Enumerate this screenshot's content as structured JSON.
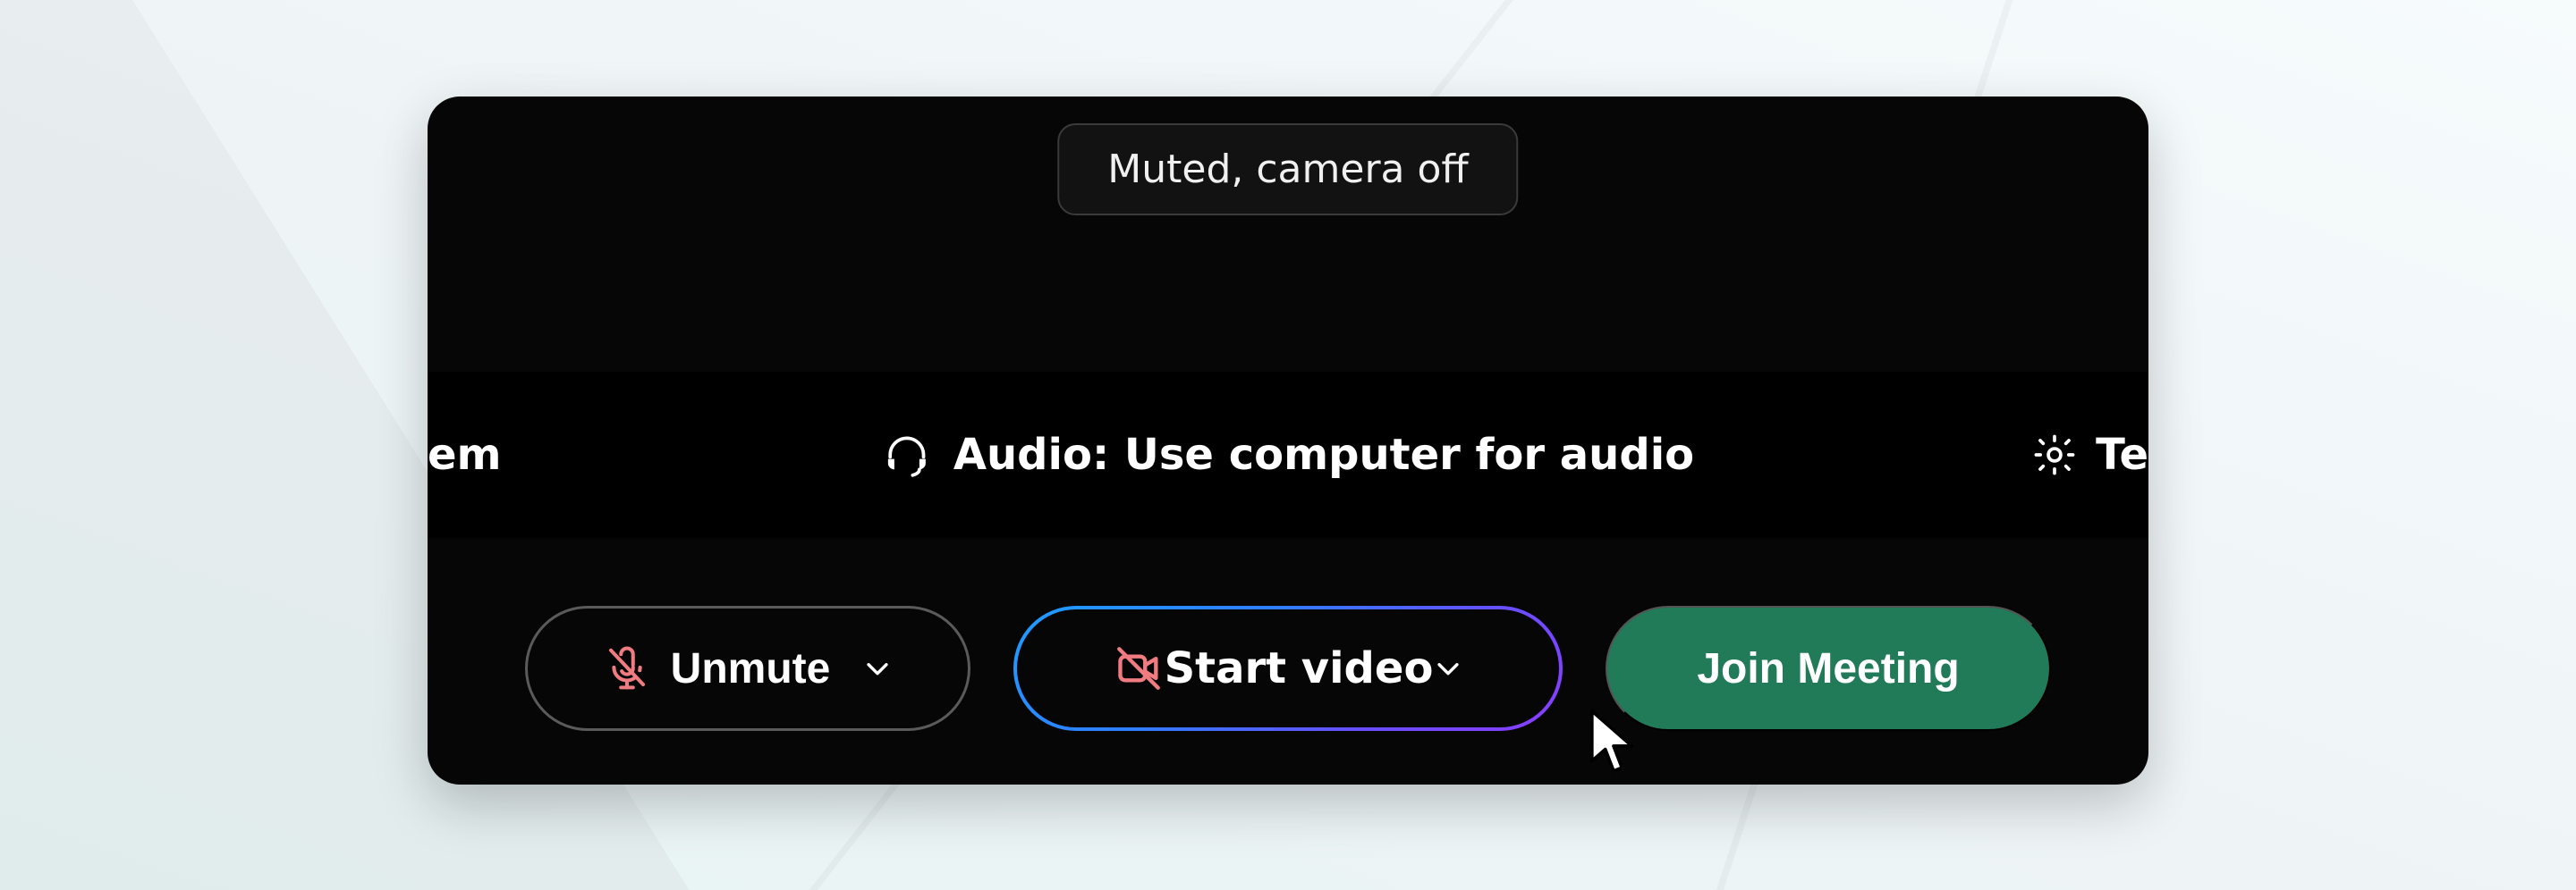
{
  "status": {
    "text": "Muted, camera off"
  },
  "strip": {
    "left_fragment": "em",
    "audio_label": "Audio: Use computer for audio",
    "right_fragment": "Te"
  },
  "controls": {
    "unmute_label": "Unmute",
    "start_video_label": "Start video",
    "join_label": "Join Meeting"
  },
  "colors": {
    "accent_green": "#217a58",
    "muted_icon": "#f07c82",
    "gradient_start": "#1f9dff",
    "gradient_end": "#8a3dff"
  }
}
